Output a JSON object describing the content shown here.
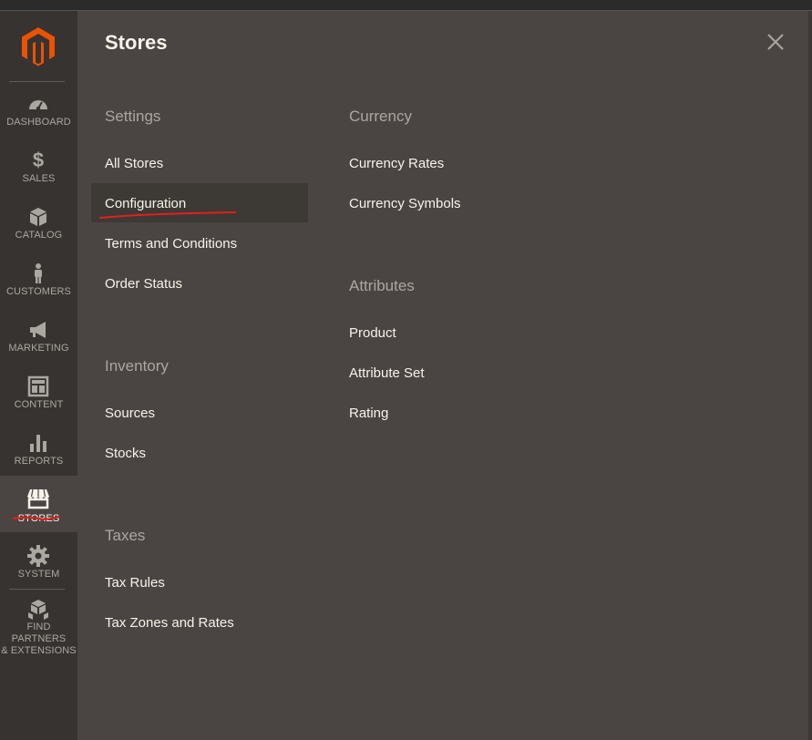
{
  "sidebar": {
    "items": [
      {
        "label": "DASHBOARD",
        "icon": "dashboard-icon"
      },
      {
        "label": "$",
        "icon": "dollar-icon"
      },
      {
        "label": "SALES"
      },
      {
        "label": "CATALOG",
        "icon": "catalog-box-icon"
      },
      {
        "label": "CUSTOMERS",
        "icon": "customer-person-icon"
      },
      {
        "label": "MARKETING",
        "icon": "megaphone-icon"
      },
      {
        "label": "CONTENT",
        "icon": "content-layout-icon"
      },
      {
        "label": "REPORTS",
        "icon": "bar-chart-icon"
      },
      {
        "label": "STORES",
        "icon": "storefront-icon"
      },
      {
        "label": "SYSTEM",
        "icon": "gear-icon"
      },
      {
        "label": "FIND PARTNERS",
        "label2": "& EXTENSIONS",
        "icon": "extensions-boxes-icon"
      }
    ]
  },
  "panel": {
    "title": "Stores",
    "settings": {
      "heading": "Settings",
      "links": [
        "All Stores",
        "Configuration",
        "Terms and Conditions",
        "Order Status"
      ]
    },
    "inventory": {
      "heading": "Inventory",
      "links": [
        "Sources",
        "Stocks"
      ]
    },
    "taxes": {
      "heading": "Taxes",
      "links": [
        "Tax Rules",
        "Tax Zones and Rates"
      ]
    },
    "currency": {
      "heading": "Currency",
      "links": [
        "Currency Rates",
        "Currency Symbols"
      ]
    },
    "attributes": {
      "heading": "Attributes",
      "links": [
        "Product",
        "Attribute Set",
        "Rating"
      ]
    }
  },
  "colors": {
    "sidebar_bg": "#373330",
    "panel_bg": "#4a4542",
    "accent": "#eb5202",
    "annotation_red": "#e02020"
  }
}
